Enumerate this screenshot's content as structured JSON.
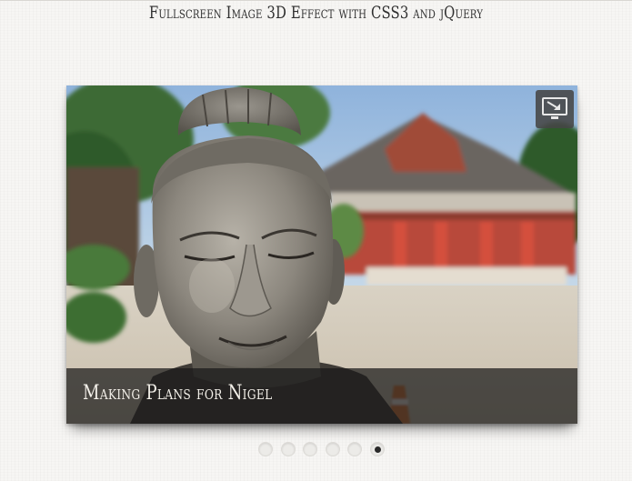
{
  "page": {
    "title": "Fullscreen Image 3D Effect with CSS3 and jQuery"
  },
  "slider": {
    "caption": "Making Plans for Nigel",
    "image_subject": "stone-statue-head-in-front-of-red-temple",
    "fullscreen_icon": "fullscreen-monitor-icon",
    "slide_count": 6,
    "active_slide": 6
  },
  "colors": {
    "background": "#f7f6f4",
    "title_text": "#2f2f2f",
    "caption_bar": "#191919",
    "caption_text": "#f2efe8",
    "button_bg": "#464646",
    "dot_inactive": "#ecebe8",
    "dot_active": "#2a2a2a"
  }
}
